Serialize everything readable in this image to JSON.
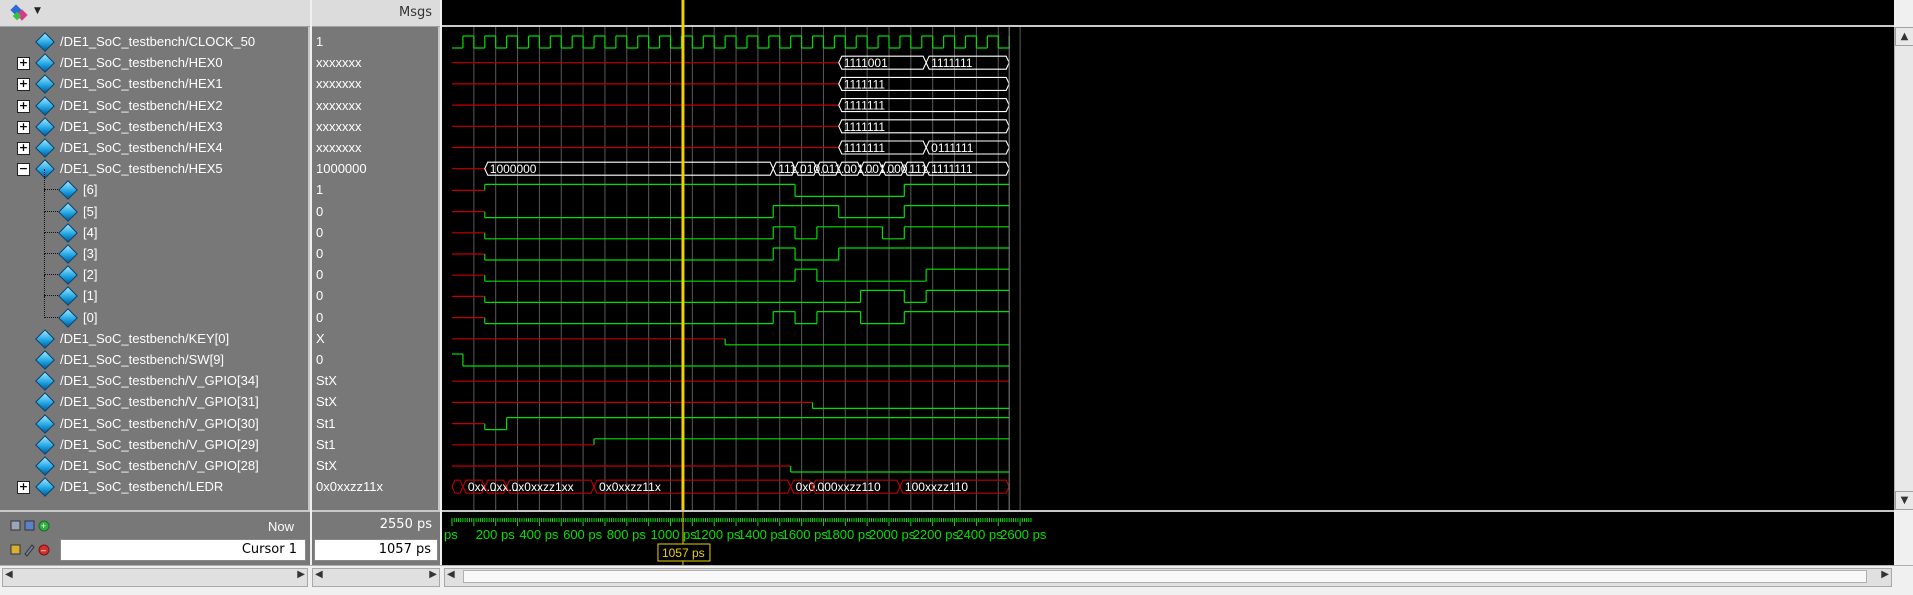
{
  "toolbar": {
    "dropdown_icon": "wave-tools-icon"
  },
  "values_header": "Msgs",
  "signals": [
    {
      "name": "/DE1_SoC_testbench/CLOCK_50",
      "value": "1",
      "expander": ""
    },
    {
      "name": "/DE1_SoC_testbench/HEX0",
      "value": "xxxxxxx",
      "expander": "+"
    },
    {
      "name": "/DE1_SoC_testbench/HEX1",
      "value": "xxxxxxx",
      "expander": "+"
    },
    {
      "name": "/DE1_SoC_testbench/HEX2",
      "value": "xxxxxxx",
      "expander": "+"
    },
    {
      "name": "/DE1_SoC_testbench/HEX3",
      "value": "xxxxxxx",
      "expander": "+"
    },
    {
      "name": "/DE1_SoC_testbench/HEX4",
      "value": "xxxxxxx",
      "expander": "+"
    },
    {
      "name": "/DE1_SoC_testbench/HEX5",
      "value": "1000000",
      "expander": "-"
    },
    {
      "name": "[6]",
      "value": "1",
      "expander": "child"
    },
    {
      "name": "[5]",
      "value": "0",
      "expander": "child"
    },
    {
      "name": "[4]",
      "value": "0",
      "expander": "child"
    },
    {
      "name": "[3]",
      "value": "0",
      "expander": "child"
    },
    {
      "name": "[2]",
      "value": "0",
      "expander": "child"
    },
    {
      "name": "[1]",
      "value": "0",
      "expander": "child"
    },
    {
      "name": "[0]",
      "value": "0",
      "expander": "child"
    },
    {
      "name": "/DE1_SoC_testbench/KEY[0]",
      "value": "X",
      "expander": ""
    },
    {
      "name": "/DE1_SoC_testbench/SW[9]",
      "value": "0",
      "expander": ""
    },
    {
      "name": "/DE1_SoC_testbench/V_GPIO[34]",
      "value": "StX",
      "expander": ""
    },
    {
      "name": "/DE1_SoC_testbench/V_GPIO[31]",
      "value": "StX",
      "expander": ""
    },
    {
      "name": "/DE1_SoC_testbench/V_GPIO[30]",
      "value": "St1",
      "expander": ""
    },
    {
      "name": "/DE1_SoC_testbench/V_GPIO[29]",
      "value": "St1",
      "expander": ""
    },
    {
      "name": "/DE1_SoC_testbench/V_GPIO[28]",
      "value": "StX",
      "expander": ""
    },
    {
      "name": "/DE1_SoC_testbench/LEDR",
      "value": "0x0xxzz11x",
      "expander": "+"
    }
  ],
  "bus_labels": {
    "hex0": [
      "1111001",
      "1111111"
    ],
    "hex1": [
      "1111111"
    ],
    "hex2": [
      "1111111"
    ],
    "hex3": [
      "1111111"
    ],
    "hex4": [
      "1111111",
      "0111111"
    ],
    "hex5": [
      "1000000",
      "111...",
      "010...",
      "011...",
      "001...",
      "001...",
      "000...",
      "111...",
      "1111111"
    ],
    "ledr": [
      "0xx...",
      "0xx...",
      "0x0xxzz1xx",
      "0x0xxzz11x",
      "0x0...",
      "000xxzz110",
      "100xxzz110"
    ]
  },
  "status": {
    "now_label": "Now",
    "now_value": "2550 ps",
    "cursor_label": "Cursor 1",
    "cursor_value": "1057 ps",
    "cursor_flag": "1057 ps"
  },
  "timeline": {
    "start_label": "ps",
    "ticks": [
      "200 ps",
      "400 ps",
      "600 ps",
      "800 ps",
      "1000 ps",
      "1200 ps",
      "1400 ps",
      "1600 ps",
      "1800 ps",
      "2000 ps",
      "2200 ps",
      "2400 ps",
      "2600 ps"
    ]
  },
  "colors": {
    "signal_green": "#00e000",
    "unknown_red": "#c00000",
    "cursor_yellow": "#f0d000",
    "bus_white": "#ffffff"
  }
}
